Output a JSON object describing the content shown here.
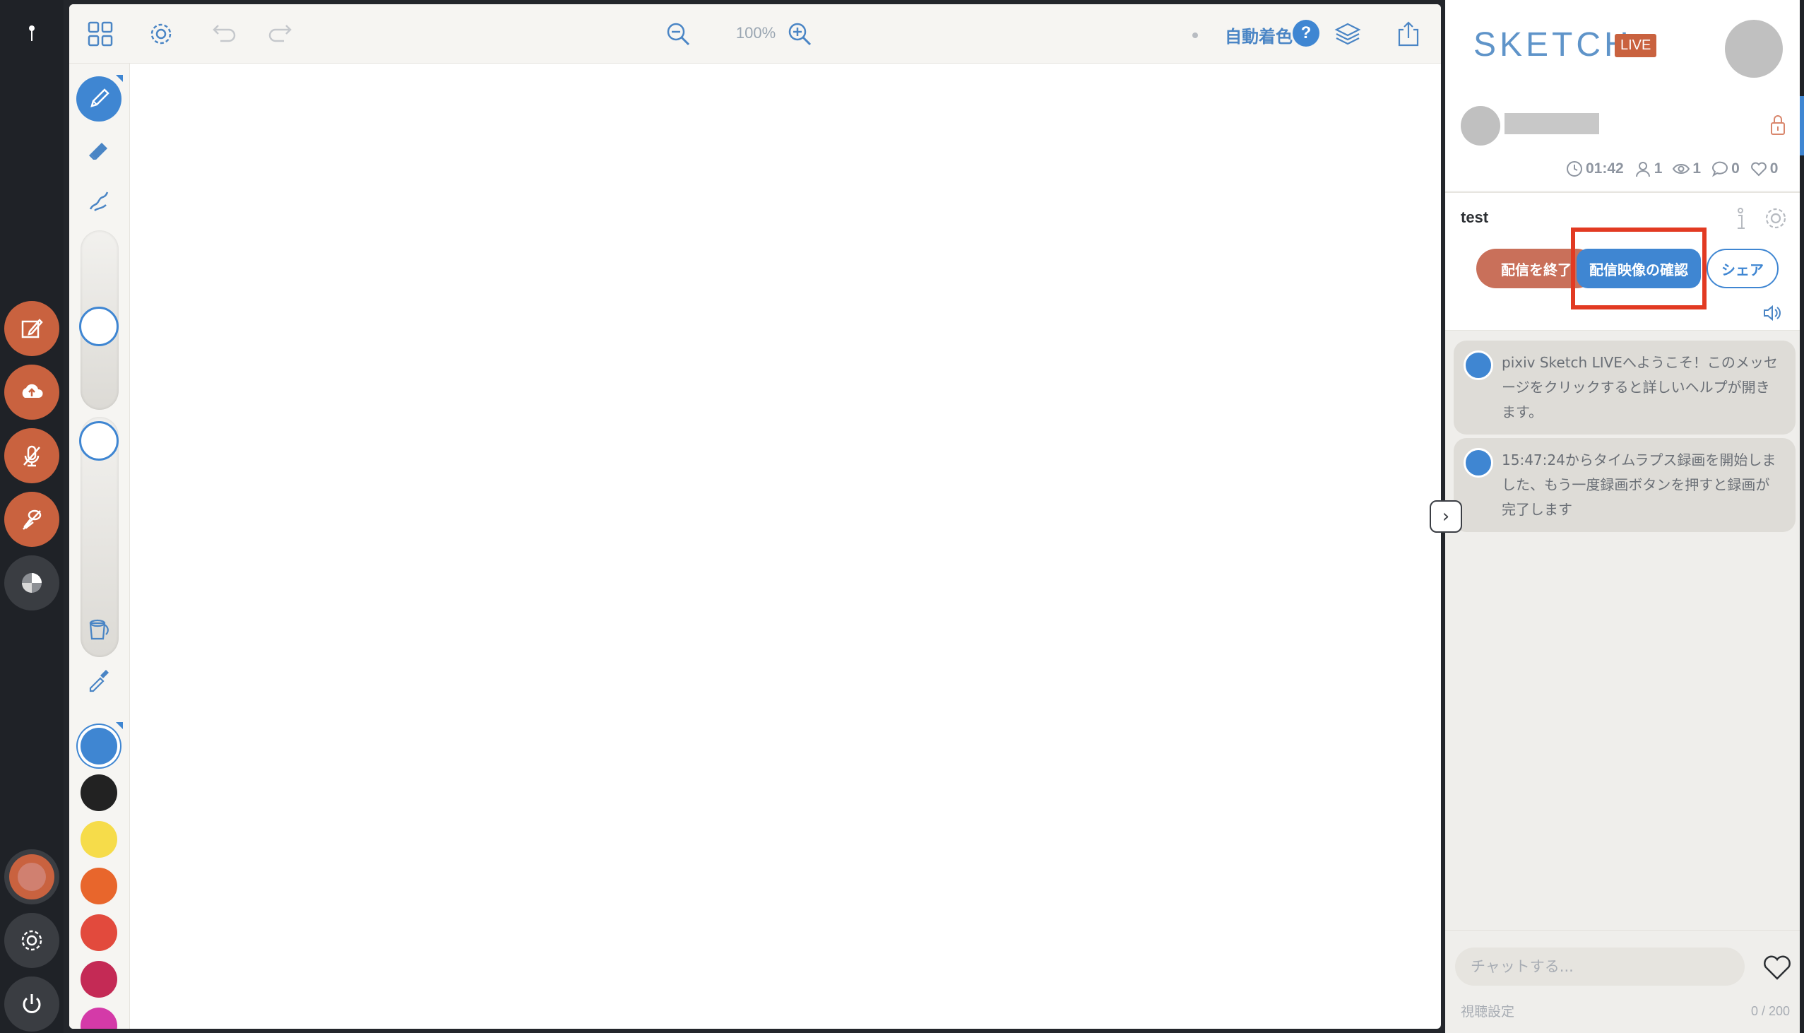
{
  "toolbar": {
    "zoom_level": "100%",
    "auto_color_label": "自動着色",
    "help_label": "?",
    "icons": [
      "grid-icon",
      "gear-icon",
      "undo-icon",
      "redo-icon",
      "zoom-out-icon",
      "zoom-in-icon",
      "layers-icon",
      "share-icon"
    ]
  },
  "tools": {
    "items": [
      "pen-icon",
      "eraser-icon",
      "smudge-icon",
      "bucket-icon",
      "eyedropper-icon"
    ],
    "brush_size_level": 0.5,
    "opacity_level": 0.0
  },
  "palette": {
    "colors": [
      "#3f86d2",
      "#222222",
      "#f6dc4a",
      "#e8662c",
      "#e24a3d",
      "#c42a55",
      "#d43aa8"
    ],
    "selected_index": 0
  },
  "rail": {
    "buttons": [
      "edit-icon",
      "cloud-upload-icon",
      "mic-off-icon",
      "brush-off-icon",
      "palette-toggle-icon"
    ],
    "bottom": [
      "user-color-icon",
      "settings-icon",
      "power-icon"
    ]
  },
  "sidebar": {
    "logo_text": "SKETCH",
    "logo_badge": "LIVE",
    "stats": {
      "time": "01:42",
      "users": "1",
      "viewers": "1",
      "comments": "0",
      "likes": "0"
    },
    "stream_title": "test",
    "buttons": {
      "end": "配信を終了",
      "confirm": "配信映像の確認",
      "share": "シェア"
    },
    "messages": [
      "pixiv Sketch LIVEへようこそ！このメッセージをクリックすると詳しいヘルプが開きます。",
      "15:47:24からタイムラプス録画を開始しました、もう一度録画ボタンを押すと録画が完了します"
    ],
    "chat": {
      "placeholder": "チャットする...",
      "view_settings": "視聴設定",
      "char_count": "0 / 200"
    }
  },
  "colors": {
    "accent_blue": "#3f86d2",
    "accent_orange": "#c9623f",
    "highlight_red": "#e23a22"
  }
}
